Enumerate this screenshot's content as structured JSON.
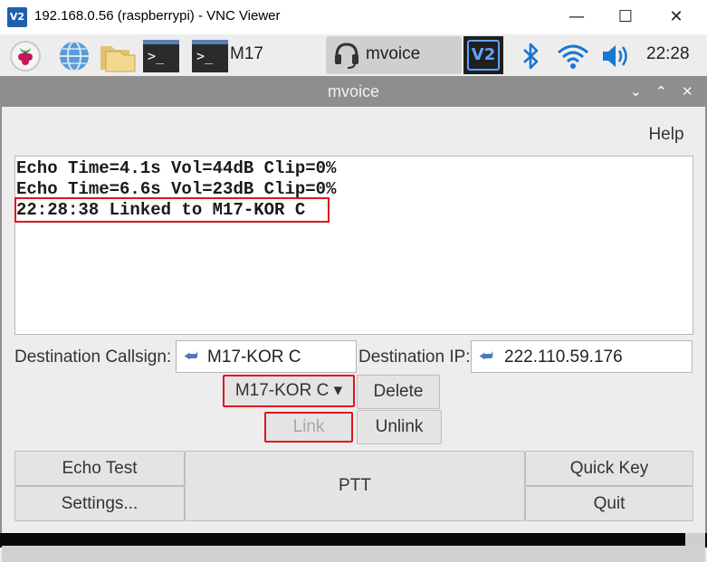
{
  "vnc_window": {
    "icon_text": "V2",
    "title": "192.168.0.56 (raspberrypi) - VNC Viewer",
    "minimize": "—",
    "maximize": "☐",
    "close": "✕"
  },
  "taskbar": {
    "terminal_glyph": ">_",
    "m17_label": "M17",
    "mvoice_label": "mvoice",
    "vnc_tray_text": "V2",
    "clock": "22:28"
  },
  "mvoice_window": {
    "title": "mvoice",
    "controls": {
      "minimize": "⌄",
      "maximize": "⌃",
      "close": "✕"
    },
    "help_menu": "Help",
    "log": {
      "lines": [
        "Echo Time=4.1s Vol=44dB Clip=0%",
        "Echo Time=6.6s Vol=23dB Clip=0%",
        "22:28:38 Linked to M17-KOR C"
      ]
    },
    "destination": {
      "callsign_label": "Destination Callsign:",
      "callsign_value": "M17-KOR C",
      "ip_label": "Destination IP:",
      "ip_value": "222.110.59.176"
    },
    "reflector_dropdown": {
      "selected": "M17-KOR C",
      "arrow": "▾"
    },
    "buttons": {
      "delete": "Delete",
      "link": "Link",
      "unlink": "Unlink",
      "echo_test": "Echo Test",
      "settings": "Settings...",
      "ptt": "PTT",
      "quick_key": "Quick Key",
      "quit": "Quit"
    }
  },
  "colors": {
    "highlight_red": "#e0141e",
    "window_title_bar": "#8e8e8e",
    "taskbar_bg": "#ededed",
    "active_task_bg": "#cfcfcf",
    "vnc_blue": "#1f5fae"
  }
}
